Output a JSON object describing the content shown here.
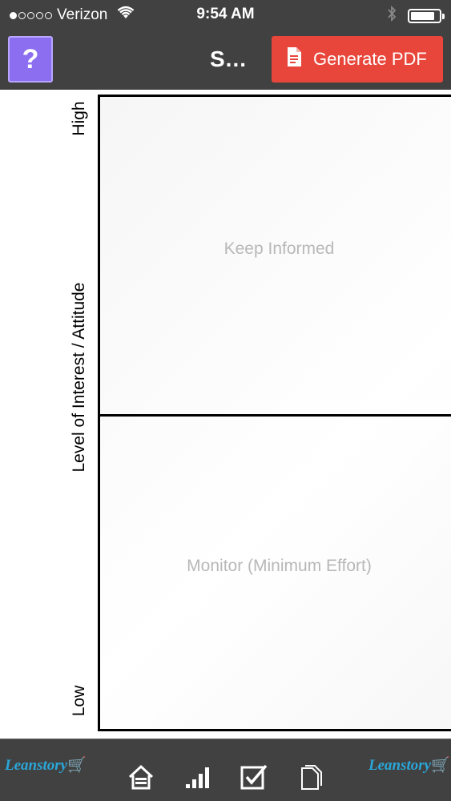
{
  "status_bar": {
    "carrier": "Verizon",
    "time": "9:54 AM",
    "signal_bars_filled": 1,
    "signal_bars_total": 5,
    "wifi_icon": "wifi-icon",
    "bluetooth_icon": "bluetooth-icon",
    "battery_level": 0.85
  },
  "nav": {
    "help_label": "?",
    "title": "S...",
    "generate_pdf_label": "Generate PDF",
    "generate_pdf_icon": "document-icon"
  },
  "chart": {
    "y_high": "High",
    "y_axis_label": "Level of Interest / Attitude",
    "y_low": "Low",
    "quadrant_top": "Keep Informed",
    "quadrant_bottom": "Monitor (Minimum Effort)"
  },
  "toolbar": {
    "logo_left": "Leanstory",
    "logo_right": "Leanstory",
    "icons": [
      "home-icon",
      "signal-bars-icon",
      "checkbox-icon",
      "documents-icon"
    ]
  },
  "colors": {
    "bar_bg": "#414141",
    "help_bg": "#8c6ff0",
    "pdf_bg": "#e8463b",
    "quadrant_text": "#b8b8b8",
    "logo_blue": "#2aa7d9",
    "logo_green": "#55c234"
  }
}
